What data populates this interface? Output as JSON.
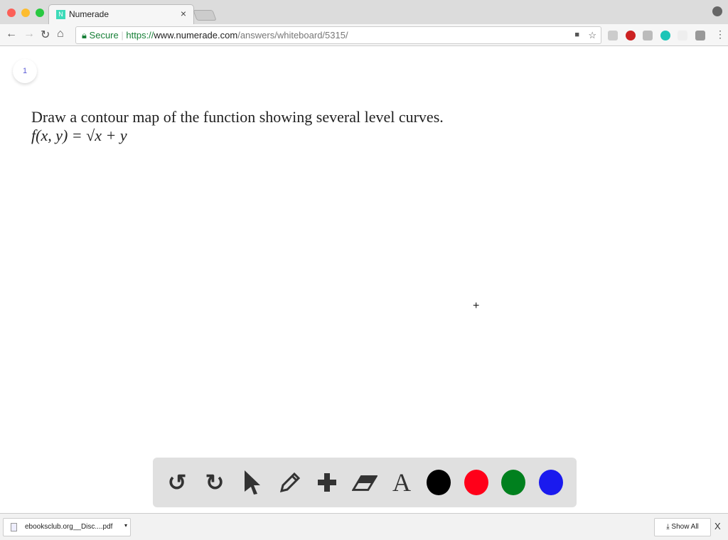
{
  "browser": {
    "tab_title": "Numerade",
    "favicon_letter": "N",
    "url_secure": "Secure",
    "url_scheme": "https://",
    "url_host": "www.numerade.com",
    "url_path": "/answers/whiteboard/5315/"
  },
  "page": {
    "page_number": "1",
    "question": "Draw a contour map of the function showing several level curves.",
    "formula": "f(x, y) = √x + y",
    "cursor": "+"
  },
  "toolbar": {
    "tools": [
      "undo",
      "redo",
      "select",
      "pencil",
      "plus",
      "eraser",
      "text"
    ],
    "text_glyph": "A",
    "colors": [
      "#000000",
      "#ff0019",
      "#00801e",
      "#1a1aee"
    ]
  },
  "downloads": {
    "file": "ebooksclub.org__Disc....pdf",
    "show_all": "Show All",
    "close": "X"
  }
}
